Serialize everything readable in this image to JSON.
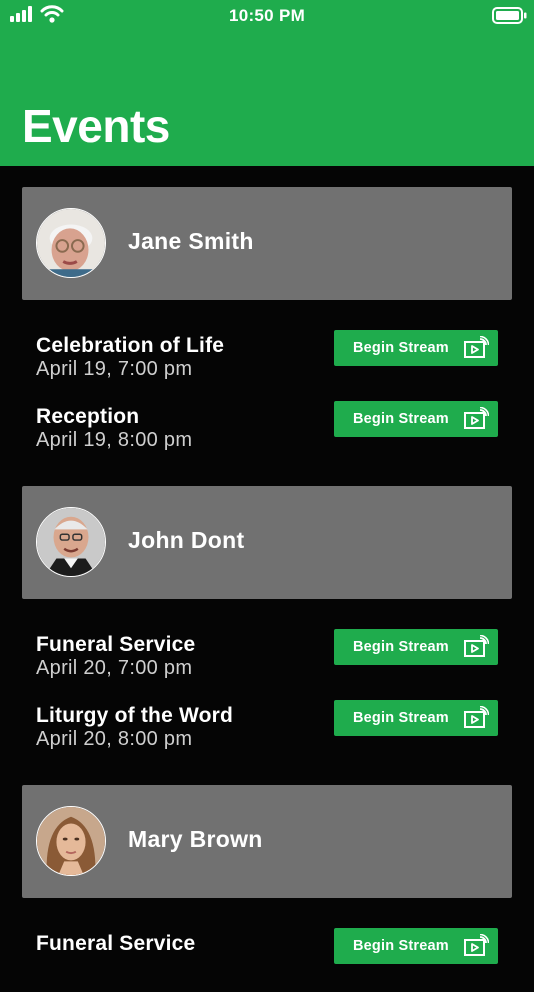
{
  "status_bar": {
    "time": "10:50 PM"
  },
  "header": {
    "title": "Events"
  },
  "groups": [
    {
      "name": "Jane Smith",
      "events": [
        {
          "title": "Celebration of Life",
          "time": "April 19, 7:00 pm",
          "button_label": "Begin Stream"
        },
        {
          "title": "Reception",
          "time": "April 19, 8:00 pm",
          "button_label": "Begin Stream"
        }
      ]
    },
    {
      "name": "John Dont",
      "events": [
        {
          "title": "Funeral Service",
          "time": "April 20, 7:00 pm",
          "button_label": "Begin Stream"
        },
        {
          "title": "Liturgy of the Word",
          "time": "April 20, 8:00 pm",
          "button_label": "Begin Stream"
        }
      ]
    },
    {
      "name": "Mary Brown",
      "events": [
        {
          "title": "Funeral Service",
          "button_label": "Begin Stream"
        }
      ]
    }
  ],
  "icons": {
    "signal": "cellular-signal-icon",
    "wifi": "wifi-icon",
    "battery": "battery-icon",
    "stream": "cast-stream-icon"
  },
  "colors": {
    "brand_green": "#1fac4d",
    "card_gray": "#717171",
    "background": "#050505"
  }
}
